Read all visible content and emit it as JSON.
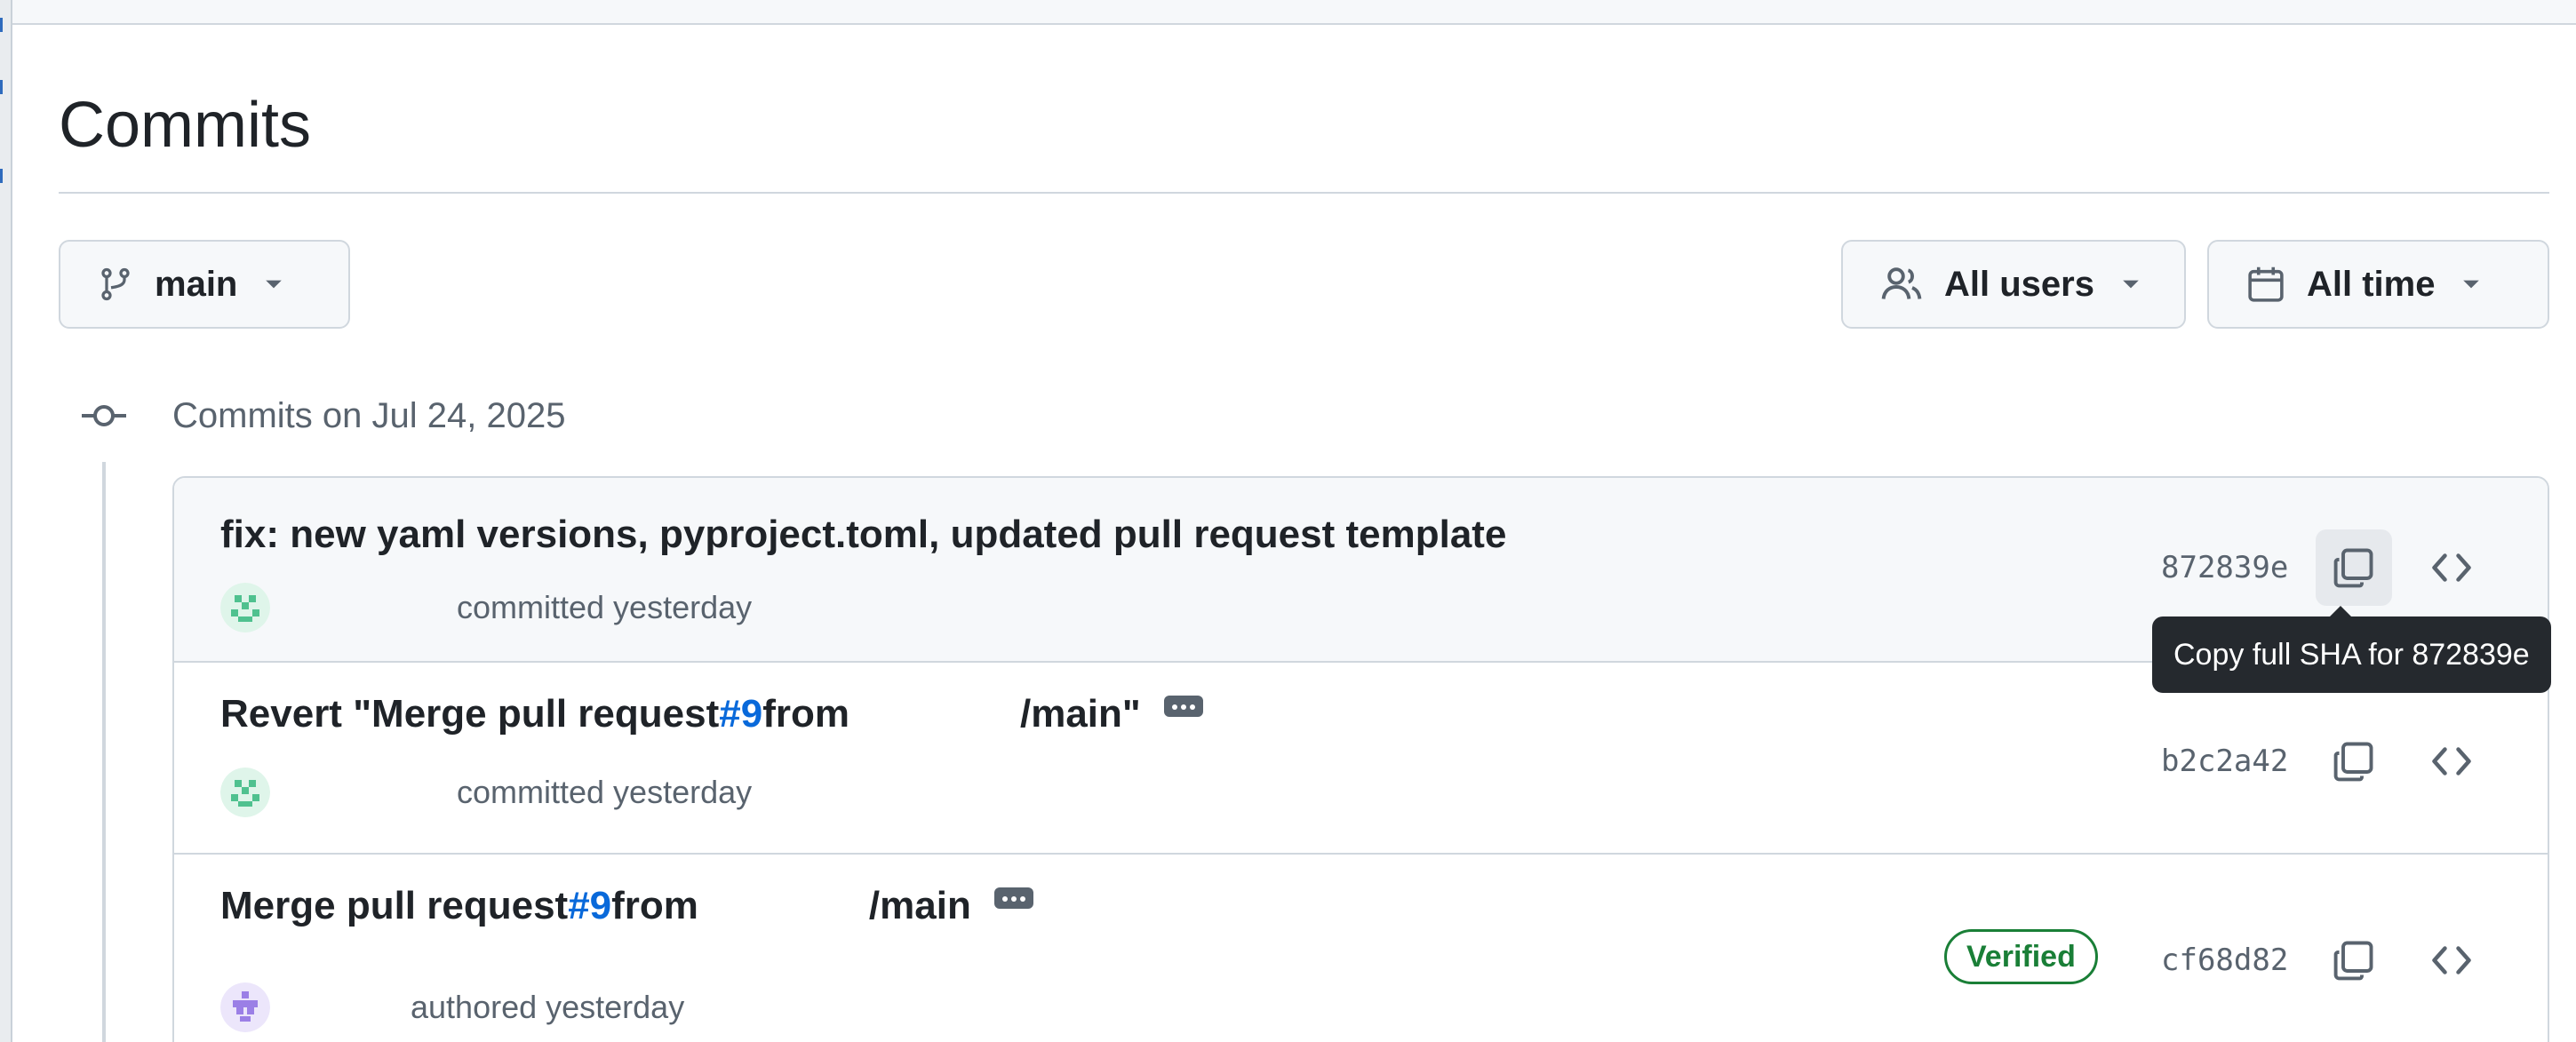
{
  "page": {
    "title": "Commits"
  },
  "filters": {
    "branch": "main",
    "users": "All users",
    "time": "All time"
  },
  "group": {
    "heading": "Commits on Jul 24, 2025"
  },
  "commits": [
    {
      "title": "fix: new yaml versions, pyproject.toml, updated pull request template",
      "meta": "committed yesterday",
      "sha": "872839e",
      "verified": false,
      "avatar_color": "#4fc18f"
    },
    {
      "title_prefix": "Revert \"Merge pull request ",
      "pr": "#9",
      "title_from": " from",
      "title_suffix": "/main\"",
      "meta": "committed yesterday",
      "sha": "b2c2a42",
      "verified": false,
      "avatar_color": "#4fc18f"
    },
    {
      "title_prefix": "Merge pull request ",
      "pr": "#9",
      "title_from": " from",
      "title_suffix": "/main",
      "meta": "authored yesterday",
      "sha": "cf68d82",
      "verified": true,
      "verified_label": "Verified",
      "avatar_color": "#9b7fe6"
    }
  ],
  "tooltip": {
    "text": "Copy full SHA for 872839e"
  },
  "colors": {
    "link": "#0969da",
    "verified": "#1a7f37",
    "muted": "#59636e",
    "border": "#d0d7de"
  },
  "icons": {
    "branch": "git-branch-icon",
    "users": "people-icon",
    "calendar": "calendar-icon",
    "commit_node": "git-commit-icon",
    "copy": "copy-icon",
    "browse": "code-icon",
    "more": "kebab-horizontal-icon",
    "caret": "triangle-down-icon"
  }
}
